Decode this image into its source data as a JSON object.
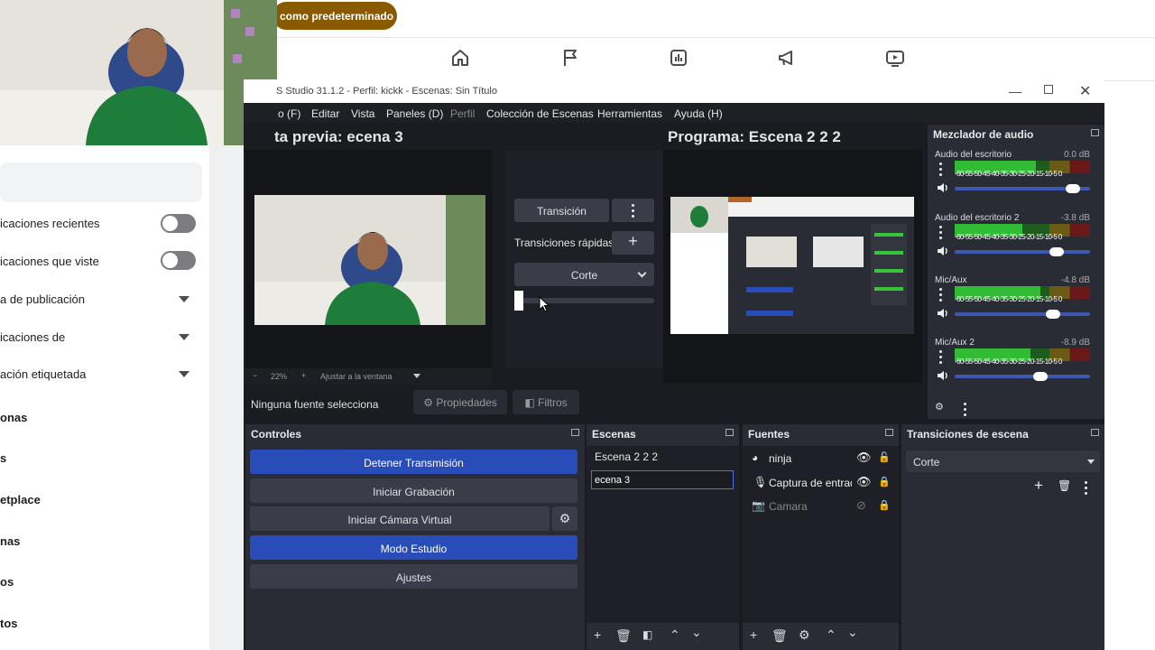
{
  "facebook": {
    "banner_button": "como predeterminado",
    "nav_icons": [
      "home-icon",
      "flag-icon",
      "chart-icon",
      "megaphone-icon",
      "video-icon"
    ],
    "sidebar": [
      {
        "label": "icaciones recientes",
        "type": "toggle"
      },
      {
        "label": "icaciones que viste",
        "type": "toggle"
      },
      {
        "label": "a de publicación",
        "type": "dropdown"
      },
      {
        "label": "icaciones de",
        "type": "dropdown"
      },
      {
        "label": "ación etiquetada",
        "type": "dropdown"
      },
      {
        "label": "onas",
        "type": "bold"
      },
      {
        "label": "s",
        "type": "bold"
      },
      {
        "label": "etplace",
        "type": "bold"
      },
      {
        "label": "nas",
        "type": "bold"
      },
      {
        "label": "os",
        "type": "bold"
      },
      {
        "label": "tos",
        "type": "bold"
      }
    ]
  },
  "obs": {
    "title": "S Studio 31.1.2 - Perfil: kickk - Escenas: Sin Título",
    "menu": [
      "o (F)",
      "Editar",
      "Vista",
      "Paneles (D)",
      "Perfil",
      "Colección de Escenas",
      "Herramientas",
      "Ayuda (H)"
    ],
    "preview_title": "ta previa: ecena 3",
    "program_title": "Programa: Escena 2 2 2",
    "zoom": {
      "percent": "22%",
      "fit": "Ajustar a la ventana"
    },
    "transition": {
      "button": "Transición",
      "quick": "Transiciones rápidas",
      "select": "Corte"
    },
    "source_bar": {
      "none": "Ninguna fuente seleccionada",
      "properties": "Propiedades",
      "filters": "Filtros"
    },
    "mixer": {
      "title": "Mezclador de audio",
      "scale": "-60-55-50-45-40-35-30-25-20-15-10-5 0",
      "channels": [
        {
          "name": "Audio del escritorio",
          "db": "0.0 dB",
          "level": 0.85,
          "volume": 0.92
        },
        {
          "name": "Audio del escritorio 2",
          "db": "-3.8 dB",
          "level": 0.72,
          "volume": 0.78
        },
        {
          "name": "Mic/Aux",
          "db": "-4.8 dB",
          "level": 0.9,
          "volume": 0.75
        },
        {
          "name": "Mic/Aux 2",
          "db": "-8.9 dB",
          "level": 0.8,
          "volume": 0.65
        }
      ]
    },
    "controls": {
      "title": "Controles",
      "stop_stream": "Detener Transmisión",
      "start_recording": "Iniciar Grabación",
      "start_virtualcam": "Iniciar Cámara Virtual",
      "studio_mode": "Modo Estudio",
      "settings": "Ajustes"
    },
    "scenes": {
      "title": "Escenas",
      "items": [
        "Escena 2 2 2",
        "ecena 3"
      ]
    },
    "sources": {
      "title": "Fuentes",
      "items": [
        {
          "name": "ninja",
          "icon": "browser-icon",
          "visible": true,
          "locked": false
        },
        {
          "name": "Captura de entrada",
          "icon": "mic-icon",
          "visible": true,
          "locked": true
        },
        {
          "name": "Camara",
          "icon": "camera-icon",
          "visible": false,
          "locked": true
        }
      ]
    },
    "scene_transitions": {
      "title": "Transiciones de escena",
      "select": "Corte"
    }
  }
}
